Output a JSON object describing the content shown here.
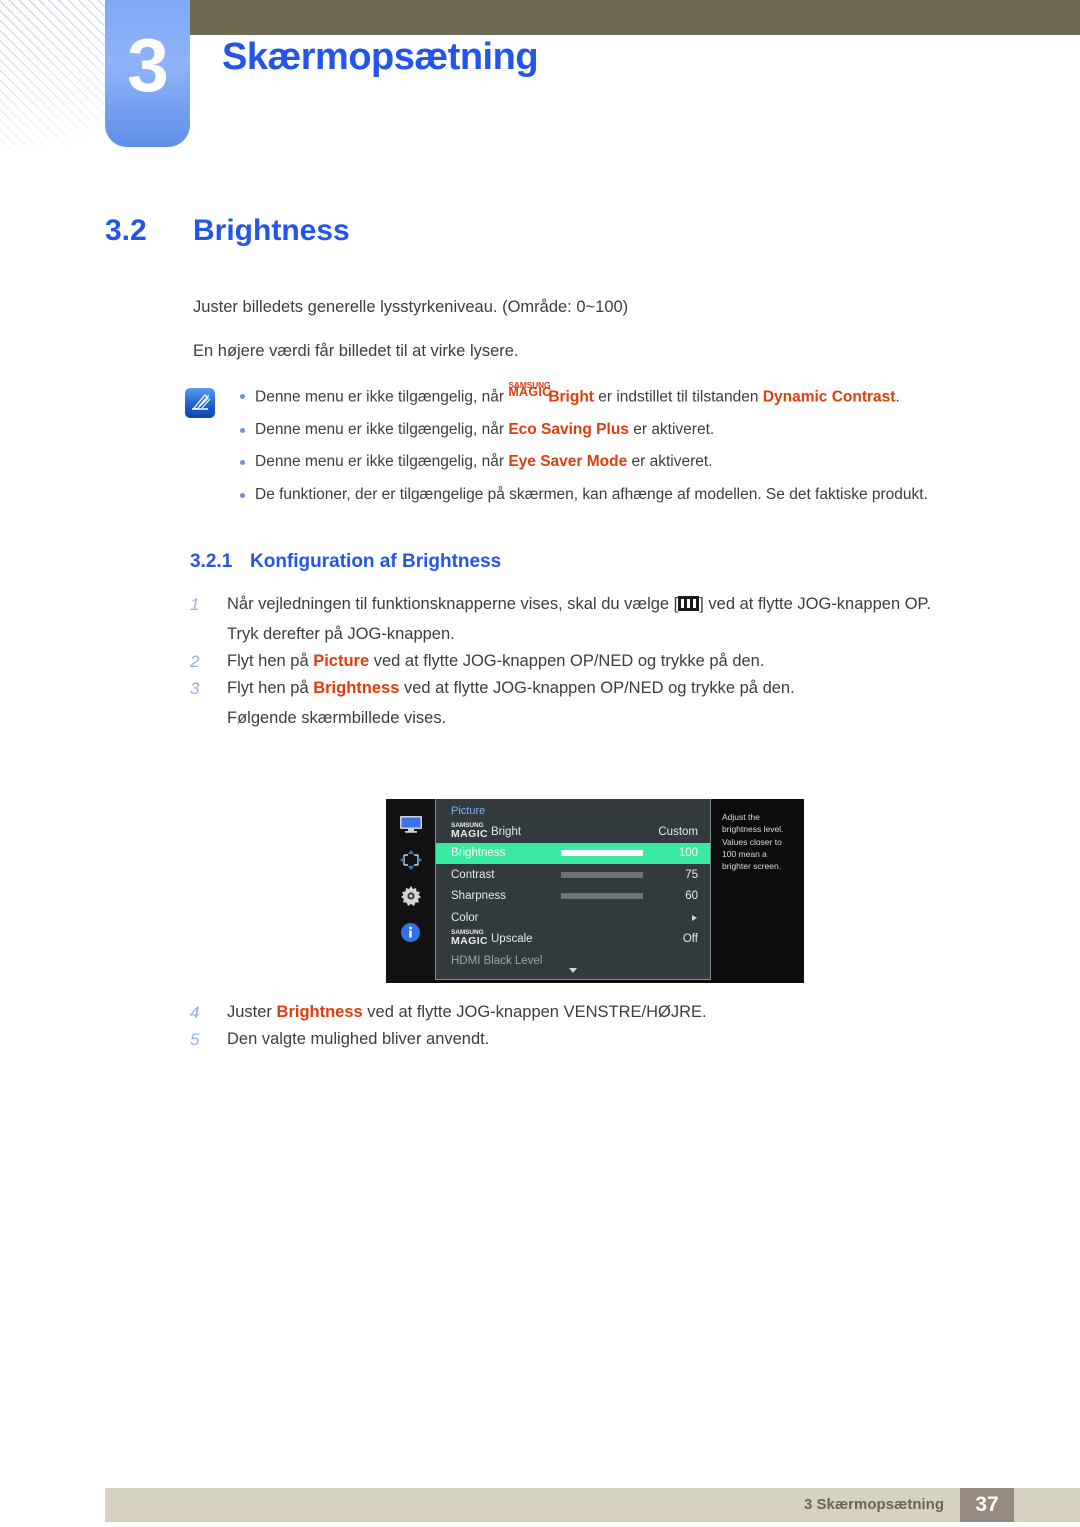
{
  "chapter": {
    "number": "3",
    "title": "Skærmopsætning"
  },
  "section": {
    "number": "3.2",
    "title": "Brightness",
    "paragraphs": [
      "Juster billedets generelle lysstyrkeniveau. (Område: 0~100)",
      "En højere værdi får billedet til at virke lysere."
    ]
  },
  "note": {
    "icon": "note-pen-icon",
    "bullets": [
      {
        "before": "Denne menu er ikke tilgængelig, når ",
        "magic_samsung": "SAMSUNG",
        "magic_magic": "MAGIC",
        "magic_word": "Bright",
        "middle": " er indstillet til tilstanden ",
        "highlight": "Dynamic Contrast",
        "after": "."
      },
      {
        "before": "Denne menu er ikke tilgængelig, når ",
        "highlight": "Eco Saving Plus",
        "after": " er aktiveret."
      },
      {
        "before": "Denne menu er ikke tilgængelig, når ",
        "highlight": "Eye Saver Mode",
        "after": " er aktiveret."
      },
      {
        "before": "De funktioner, der er tilgængelige på skærmen, kan afhænge af modellen. Se det faktiske produkt.",
        "highlight": "",
        "after": ""
      }
    ]
  },
  "subsection": {
    "number": "3.2.1",
    "title": "Konfiguration af Brightness"
  },
  "steps": [
    {
      "n": "1",
      "text_before": "Når vejledningen til funktionsknapperne vises, skal du vælge [",
      "glyph": "menu-icon",
      "text_after": "] ved at flytte JOG-knappen OP.",
      "sub": "Tryk derefter på JOG-knappen."
    },
    {
      "n": "2",
      "text_before": "Flyt hen på ",
      "highlight": "Picture",
      "text_after": " ved at flytte JOG-knappen OP/NED og trykke på den.",
      "sub": ""
    },
    {
      "n": "3",
      "text_before": "Flyt hen på ",
      "highlight": "Brightness",
      "text_after": " ved at flytte JOG-knappen OP/NED og trykke på den.",
      "sub": "Følgende skærmbillede vises."
    }
  ],
  "steps2": [
    {
      "n": "4",
      "text_before": "Juster ",
      "highlight": "Brightness",
      "text_after": " ved at flytte JOG-knappen VENSTRE/HØJRE."
    },
    {
      "n": "5",
      "text_before": "Den valgte mulighed bliver anvendt.",
      "highlight": "",
      "text_after": ""
    }
  ],
  "osd": {
    "title": "Picture",
    "rail_icons": [
      "monitor-icon",
      "move-arrows-icon",
      "gear-icon",
      "info-icon"
    ],
    "rows": [
      {
        "samsung": "SAMSUNG",
        "magic": "MAGIC",
        "label": "Bright",
        "value": "Custom",
        "bar": null,
        "highlighted": false
      },
      {
        "label": "Brightness",
        "value": "100",
        "bar": 100,
        "highlighted": true
      },
      {
        "label": "Contrast",
        "value": "75",
        "bar": 75,
        "highlighted": false
      },
      {
        "label": "Sharpness",
        "value": "60",
        "bar": 60,
        "highlighted": false
      },
      {
        "label": "Color",
        "value": "",
        "bar": null,
        "highlighted": false,
        "arrow": true
      },
      {
        "samsung": "SAMSUNG",
        "magic": "MAGIC",
        "label": "Upscale",
        "value": "Off",
        "bar": null,
        "highlighted": false
      },
      {
        "label": "HDMI Black Level",
        "value": "",
        "bar": null,
        "highlighted": false,
        "dim": true
      }
    ],
    "tooltip": "Adjust the brightness level. Values closer to 100 mean a brighter screen.",
    "highlight_color": "#3ae9a2"
  },
  "footer": {
    "text": "3 Skærmopsætning",
    "page": "37"
  }
}
